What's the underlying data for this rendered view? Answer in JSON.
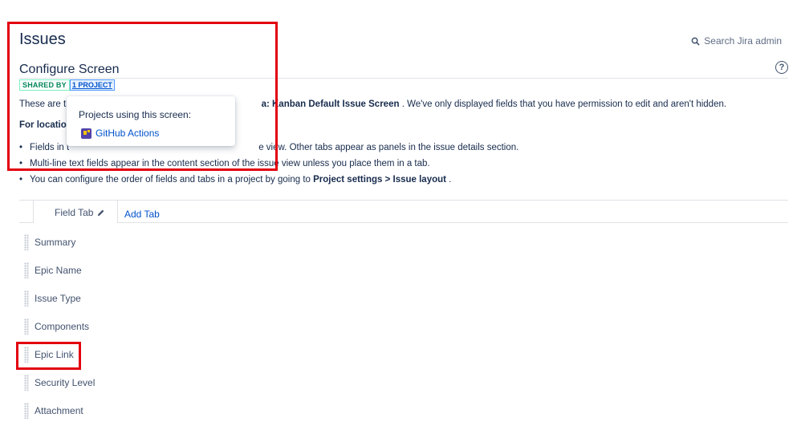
{
  "header": {
    "title": "Issues",
    "search_label": "Search Jira admin"
  },
  "screen": {
    "title": "Configure Screen",
    "help_symbol": "?",
    "shared_badge": "SHARED BY",
    "shared_link": "1 PROJECT"
  },
  "intro": {
    "before": "These are th",
    "bold": "a: Kanban Default Issue Screen",
    "after": " . We've only displayed fields that you have permission to edit and aren't hidden.",
    "for_location": "For location"
  },
  "bullets": [
    {
      "a": "Fields in t",
      "b": "e view. Other tabs appear as panels in the issue details section."
    },
    {
      "a": "Multi-line text fields appear in the content section of the issue view unless you place them in a tab.",
      "b": ""
    },
    {
      "a": "You can configure the order of fields and tabs in a project by going to ",
      "bold": "Project settings > Issue layout",
      "b": " ."
    }
  ],
  "popup": {
    "title": "Projects using this screen:",
    "project": "GitHub Actions"
  },
  "tabs": {
    "active": "Field Tab",
    "add": "Add Tab"
  },
  "fields": [
    "Summary",
    "Epic Name",
    "Issue Type",
    "Components",
    "Epic Link",
    "Security Level",
    "Attachment"
  ],
  "colors": {
    "highlight": "#e3000f",
    "link": "#0052cc",
    "shared_green": "#00875a"
  }
}
